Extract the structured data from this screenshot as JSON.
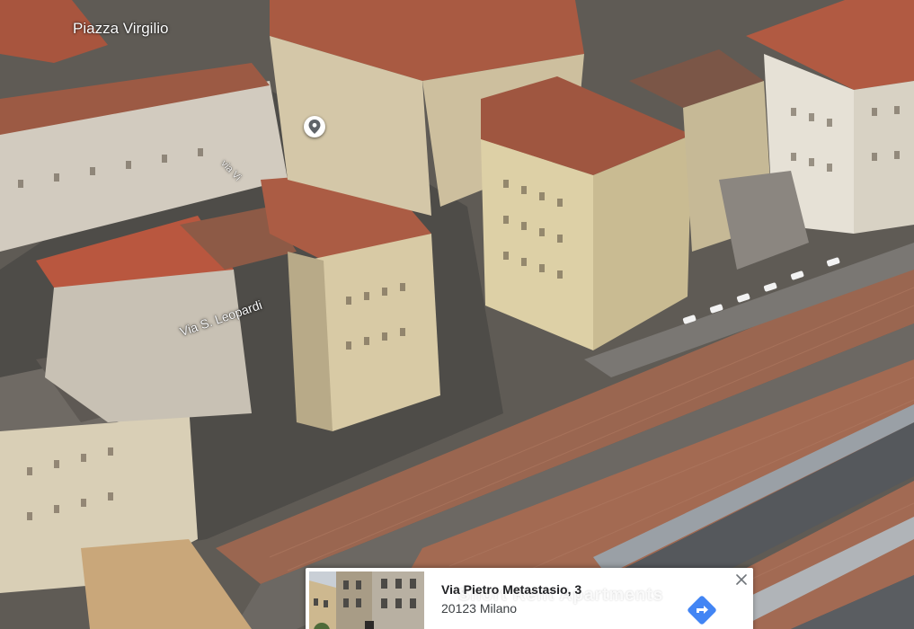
{
  "map": {
    "place_label": "Piazza Virgilio",
    "street_label_1": "via Vi",
    "street_label_2": "Via S. Leopardi",
    "pin_icon": "place-pin-icon"
  },
  "card": {
    "title": "Via Pietro Metastasio, 3",
    "city": "20123 Milano",
    "overlay_text": "Short Rent Apartments",
    "close_icon": "close-icon",
    "directions_icon": "directions-icon",
    "accent_color": "#4285f4"
  }
}
